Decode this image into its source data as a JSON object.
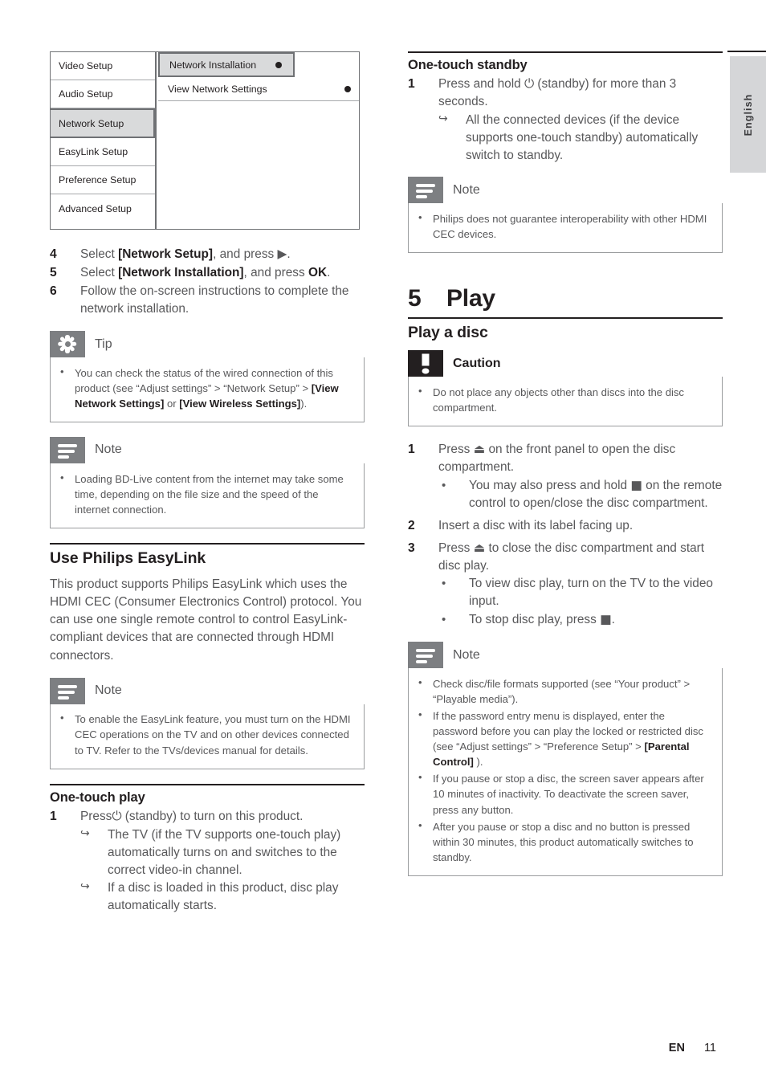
{
  "language_tab": "English",
  "footer": {
    "lang_code": "EN",
    "page_number": "11"
  },
  "osd_menu": {
    "left_items": [
      "Video Setup",
      "Audio Setup",
      "Network Setup",
      "EasyLink Setup",
      "Preference Setup",
      "Advanced Setup"
    ],
    "selected_left_item": "Network Setup",
    "right_items": [
      "Network Installation",
      "View Network Settings"
    ],
    "highlighted_right_item": "Network Installation"
  },
  "left_column": {
    "network_steps": [
      {
        "num": "4",
        "pre": "Select ",
        "kw": "[Network Setup]",
        "post": ", and press ▶."
      },
      {
        "num": "5",
        "pre": "Select ",
        "kw": "[Network Installation]",
        "post": ", and press ",
        "kw2": "OK",
        "post2": "."
      },
      {
        "num": "6",
        "pre": "Follow the on-screen instructions to complete the network installation.",
        "kw": "",
        "post": ""
      }
    ],
    "tip_box": {
      "icon": "asterisk-icon",
      "title": "Tip",
      "bullets": [
        {
          "p1": "You can check the status of the wired connection of this product (see “Adjust settings” > “Network Setup” > ",
          "b1": "[View Network Settings]",
          "p2": " or ",
          "b2": "[View Wireless Settings]",
          "p3": ")."
        }
      ]
    },
    "note_box_1": {
      "icon": "note-icon",
      "title": "Note",
      "bullets": [
        {
          "p1": "Loading BD-Live content from the internet may take some time, depending on the file size and the speed of the internet connection."
        }
      ]
    },
    "easylink_heading": "Use Philips EasyLink",
    "easylink_paragraph": "This product supports Philips EasyLink which uses the HDMI CEC (Consumer Electronics Control) protocol. You can use one single remote control to control EasyLink-compliant devices that are connected through HDMI connectors.",
    "note_box_2": {
      "icon": "note-icon",
      "title": "Note",
      "bullets": [
        {
          "p1": "To enable the EasyLink feature, you must turn on the HDMI CEC operations on the TV and on other devices connected to TV. Refer to the TVs/devices manual for details."
        }
      ]
    },
    "one_touch_play": {
      "heading": "One-touch play",
      "step_num": "1",
      "step_text_pre": "Press",
      "step_symbol": "⏻",
      "step_text_post": " (standby) to turn on this product.",
      "results": [
        "The TV (if the TV supports one-touch play) automatically turns on and switches to the correct video-in channel.",
        "If a disc is loaded in this product, disc play automatically starts."
      ]
    }
  },
  "right_column": {
    "one_touch_standby": {
      "heading": "One-touch standby",
      "step_num": "1",
      "step_text_pre": "Press and hold ",
      "step_symbol": "⏻",
      "step_text_post": " (standby) for more than 3 seconds.",
      "results": [
        "All the connected devices (if the device supports one-touch standby) automatically switch to standby."
      ]
    },
    "note_box_1": {
      "icon": "note-icon",
      "title": "Note",
      "bullets": [
        {
          "p1": "Philips does not guarantee interoperability with other HDMI CEC devices."
        }
      ]
    },
    "chapter": {
      "number": "5",
      "title": "Play"
    },
    "section_title": "Play a disc",
    "caution_box": {
      "icon": "exclamation-icon",
      "title": "Caution",
      "bullets": [
        {
          "p1": "Do not place any objects other than discs into the disc compartment."
        }
      ]
    },
    "disc_steps": [
      {
        "num": "1",
        "pre": "Press ",
        "symbol": "⏏",
        "post": " on the front panel to open the disc compartment.",
        "subs": [
          {
            "pre": "You may also press and hold ",
            "symbol": "■",
            "post": " on the remote control to open/close the disc compartment."
          }
        ]
      },
      {
        "num": "2",
        "pre": "Insert a disc with its label facing up.",
        "symbol": "",
        "post": "",
        "subs": []
      },
      {
        "num": "3",
        "pre": "Press ",
        "symbol": "⏏",
        "post": " to close the disc compartment and start disc play.",
        "subs": [
          {
            "pre": "To view disc play, turn on the TV to the video input.",
            "symbol": "",
            "post": ""
          },
          {
            "pre": "To stop disc play, press ",
            "symbol": "■",
            "post": "."
          }
        ]
      }
    ],
    "note_box_2": {
      "icon": "note-icon",
      "title": "Note",
      "bullets": [
        {
          "p1": "Check disc/file formats supported (see “Your product” > “Playable media”)."
        },
        {
          "p1": "If the password entry menu is displayed, enter the password before you can play the locked or restricted disc (see “Adjust settings” > “Preference Setup” > ",
          "b1": "[Parental Control]",
          "p2": " )."
        },
        {
          "p1": "If you pause or stop a disc, the screen saver appears after 10 minutes of inactivity. To deactivate the screen saver, press any button."
        },
        {
          "p1": "After you pause or stop a disc and no button is pressed within 30 minutes, this product automatically switches to standby."
        }
      ]
    }
  }
}
